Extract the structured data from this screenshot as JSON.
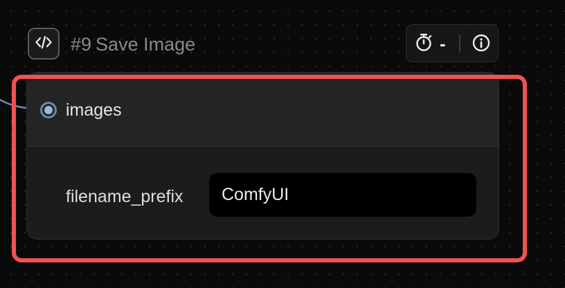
{
  "node": {
    "id": "#9",
    "title": "Save Image",
    "badge_icon": "code-brackets-icon",
    "toolbar": {
      "timer_icon": "stopwatch-icon",
      "timer_value": "-",
      "info_icon": "info-icon"
    },
    "inputs": [
      {
        "label": "images",
        "slot_color": "#9fb8d0"
      }
    ],
    "widgets": [
      {
        "label": "filename_prefix",
        "value": "ComfyUI"
      }
    ]
  },
  "highlight": {
    "color": "#f15252"
  }
}
